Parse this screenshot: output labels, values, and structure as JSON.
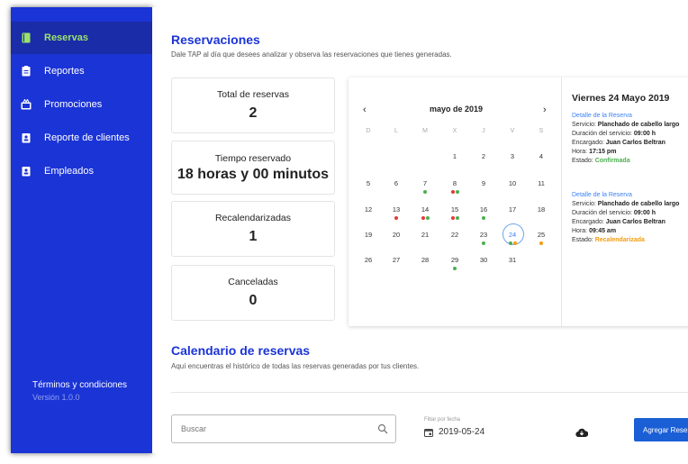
{
  "sidebar": {
    "items": [
      {
        "label": "Reservas",
        "icon": "book-icon",
        "active": true
      },
      {
        "label": "Reportes",
        "icon": "clipboard-icon"
      },
      {
        "label": "Promociones",
        "icon": "gift-icon"
      },
      {
        "label": "Reporte de clientes",
        "icon": "badge-icon"
      },
      {
        "label": "Empleados",
        "icon": "badge-icon"
      }
    ],
    "terms": "Términos y condiciones",
    "version": "Versión 1.0.0"
  },
  "header": {
    "title": "Reservaciones",
    "subtitle": "Dale TAP al día que desees analizar y observa las reservaciones que tienes generadas."
  },
  "stats": [
    {
      "title": "Total de reservas",
      "value": "2"
    },
    {
      "title": "Tiempo reservado",
      "value": "18 horas y 00 minutos"
    },
    {
      "title": "Recalendarizadas",
      "value": "1"
    },
    {
      "title": "Canceladas",
      "value": "0"
    }
  ],
  "calendar": {
    "month": "mayo de 2019",
    "prev": "‹",
    "next": "›",
    "weekdays": [
      "D",
      "L",
      "M",
      "X",
      "J",
      "V",
      "S"
    ],
    "weeks": [
      [
        "",
        "",
        "",
        "1",
        "2",
        "3",
        "4"
      ],
      [
        "5",
        "6",
        "7",
        "8",
        "9",
        "10",
        "11"
      ],
      [
        "12",
        "13",
        "14",
        "15",
        "16",
        "17",
        "18"
      ],
      [
        "19",
        "20",
        "21",
        "22",
        "23",
        "24",
        "25"
      ],
      [
        "26",
        "27",
        "28",
        "29",
        "30",
        "31",
        ""
      ]
    ],
    "selected": "24",
    "dots": {
      "7": [
        "green"
      ],
      "8": [
        "red",
        "green"
      ],
      "13": [
        "red"
      ],
      "14": [
        "red",
        "green"
      ],
      "15": [
        "red",
        "green"
      ],
      "16": [
        "green"
      ],
      "23": [
        "green"
      ],
      "24": [
        "green",
        "orange"
      ],
      "25": [
        "orange"
      ],
      "29": [
        "green"
      ]
    }
  },
  "details": {
    "date_title": "Viernes 24 Mayo 2019",
    "entries": [
      {
        "link": "Detalle de la Reserva",
        "service_label": "Servicio:",
        "service": "Planchado de cabello largo",
        "duration_label": "Duración del servicio:",
        "duration": "09:00 h",
        "staff_label": "Encargado:",
        "staff": "Juan Carlos Beltran",
        "time_label": "Hora:",
        "time": "17:15 pm",
        "status_label": "Estado:",
        "status": "Confirmada"
      },
      {
        "link": "Detalle de la Reserva",
        "service_label": "Servicio:",
        "service": "Planchado de cabello largo",
        "duration_label": "Duración del servicio:",
        "duration": "09:00 h",
        "staff_label": "Encargado:",
        "staff": "Juan Carlos Beltran",
        "time_label": "Hora:",
        "time": "09:45 am",
        "status_label": "Estado:",
        "status": "Recalendarizada"
      }
    ]
  },
  "history": {
    "title": "Calendario de reservas",
    "subtitle": "Aquí encuentras el histórico de todas las reservas generadas por tus clientes."
  },
  "toolbar": {
    "search_placeholder": "Buscar",
    "filter_label": "Filtar por fecha",
    "filter_date": "2019-05-24",
    "add_button": "Agregar Reserva"
  },
  "colors": {
    "sidebar_bg": "#1b34d6",
    "active_text": "#9be26a",
    "accent": "#1b34d6",
    "dot_green": "#4caf50",
    "dot_red": "#e53935",
    "dot_orange": "#f39c12"
  }
}
